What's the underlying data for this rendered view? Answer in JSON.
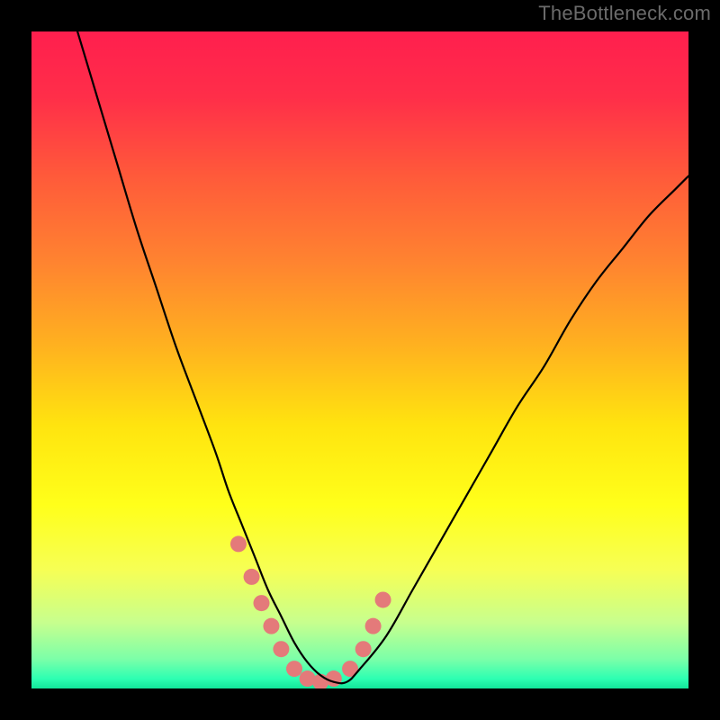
{
  "watermark": "TheBottleneck.com",
  "gradient": {
    "stops": [
      {
        "offset": 0.0,
        "color": "#ff1f4e"
      },
      {
        "offset": 0.1,
        "color": "#ff2e49"
      },
      {
        "offset": 0.22,
        "color": "#ff5a3a"
      },
      {
        "offset": 0.35,
        "color": "#ff8330"
      },
      {
        "offset": 0.48,
        "color": "#ffb21f"
      },
      {
        "offset": 0.6,
        "color": "#ffe40f"
      },
      {
        "offset": 0.72,
        "color": "#ffff1a"
      },
      {
        "offset": 0.82,
        "color": "#f6ff55"
      },
      {
        "offset": 0.9,
        "color": "#c7ff8e"
      },
      {
        "offset": 0.955,
        "color": "#7cffa8"
      },
      {
        "offset": 0.985,
        "color": "#2dffb2"
      },
      {
        "offset": 1.0,
        "color": "#12e69a"
      }
    ]
  },
  "chart_data": {
    "type": "line",
    "title": "",
    "xlabel": "",
    "ylabel": "",
    "xlim": [
      0,
      100
    ],
    "ylim": [
      0,
      100
    ],
    "series": [
      {
        "name": "bottleneck-curve",
        "x": [
          7,
          10,
          13,
          16,
          19,
          22,
          25,
          28,
          30,
          32,
          34,
          36,
          38,
          40,
          42,
          44,
          46,
          48,
          50,
          54,
          58,
          62,
          66,
          70,
          74,
          78,
          82,
          86,
          90,
          94,
          98,
          100
        ],
        "values": [
          100,
          90,
          80,
          70,
          61,
          52,
          44,
          36,
          30,
          25,
          20,
          15,
          11,
          7,
          4,
          2,
          1,
          1,
          3,
          8,
          15,
          22,
          29,
          36,
          43,
          49,
          56,
          62,
          67,
          72,
          76,
          78
        ]
      },
      {
        "name": "highlight-dots",
        "x": [
          31.5,
          33.5,
          35.0,
          36.5,
          38.0,
          40.0,
          42.0,
          44.0,
          46.0,
          48.5,
          50.5,
          52.0,
          53.5
        ],
        "values": [
          22.0,
          17.0,
          13.0,
          9.5,
          6.0,
          3.0,
          1.5,
          1.0,
          1.5,
          3.0,
          6.0,
          9.5,
          13.5
        ]
      }
    ]
  }
}
